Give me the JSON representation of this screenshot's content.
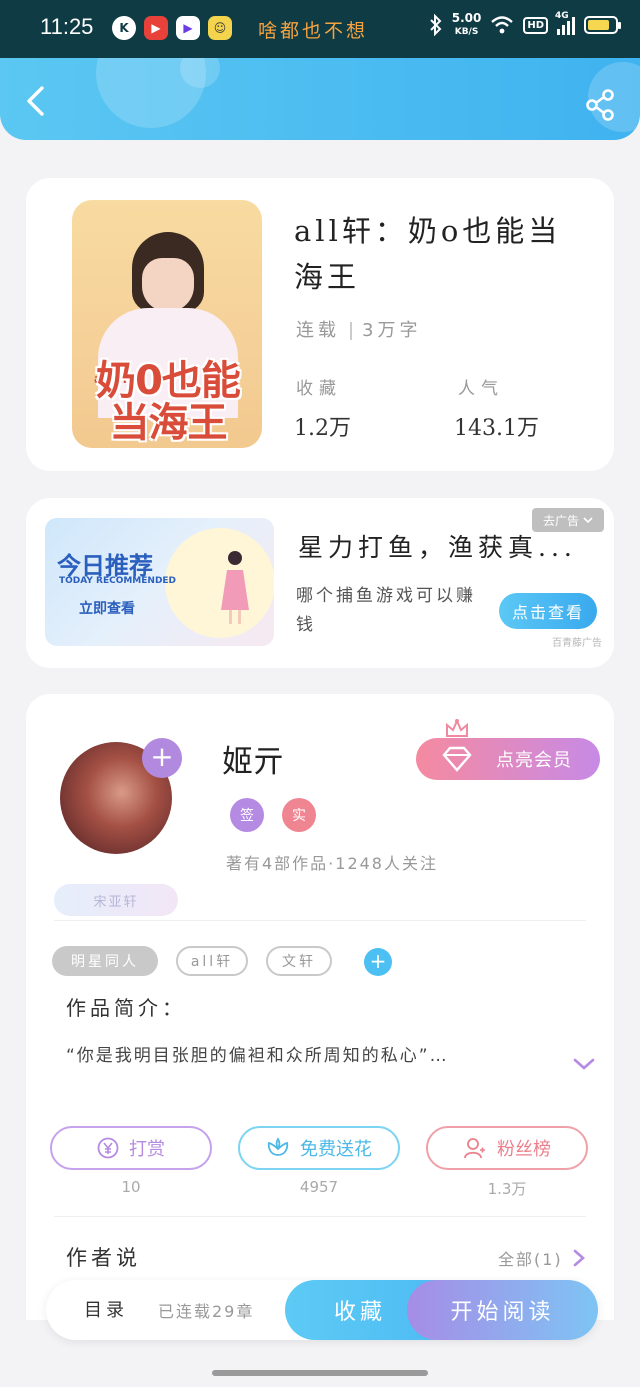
{
  "status_bar": {
    "time": "11:25",
    "slogan": "啥都也不想",
    "speed_value": "5.00",
    "speed_unit": "KB/S",
    "hd": "HD",
    "network": "4G",
    "app_icons": [
      "k-app-icon",
      "video-app-icon",
      "media-app-icon",
      "messenger-app-icon"
    ],
    "battery_level": 0.8
  },
  "header": {
    "back_icon": "chevron-left-icon",
    "share_icon": "share-icon",
    "colors": {
      "start": "#5bc7f2",
      "end": "#3fb3f0"
    }
  },
  "book": {
    "cover_small": "all轩:",
    "cover_title": "奶0也能当海王",
    "title": "all轩：奶o也能当海王",
    "status": "连载",
    "word_count": "3万字",
    "favorites_label": "收藏",
    "favorites_value": "1.2万",
    "popularity_label": "人气",
    "popularity_value": "143.1万"
  },
  "ad": {
    "banner_title": "今日推荐",
    "banner_sub": "TODAY RECOMMENDED",
    "banner_button": "立即查看",
    "headline": "星力打鱼，渔获真...",
    "description": "哪个捕鱼游戏可以赚钱",
    "cta": "点击查看",
    "close_label": "去广告",
    "ad_tag": "百青藤广告"
  },
  "author": {
    "name": "姬亓",
    "badge_sign": "签",
    "badge_real": "实",
    "info": "著有4部作品·1248人关注",
    "vip_label": "点亮会员",
    "fan_tag": "宋亚轩",
    "tags": [
      "明星同人",
      "all轩",
      "文轩"
    ],
    "intro_heading": "作品简介：",
    "intro_text": "“你是我明目张胆的偏袒和众所周知的私心”…",
    "actions": {
      "reward_label": "打赏",
      "reward_count": "10",
      "flower_label": "免费送花",
      "flower_count": "4957",
      "fans_label": "粉丝榜",
      "fans_count": "1.3万"
    },
    "author_says": "作者说",
    "all_label": "全部(1)"
  },
  "bottom_bar": {
    "toc": "目录",
    "chapters": "已连载29章",
    "favorite": "收藏",
    "start_reading": "开始阅读"
  }
}
